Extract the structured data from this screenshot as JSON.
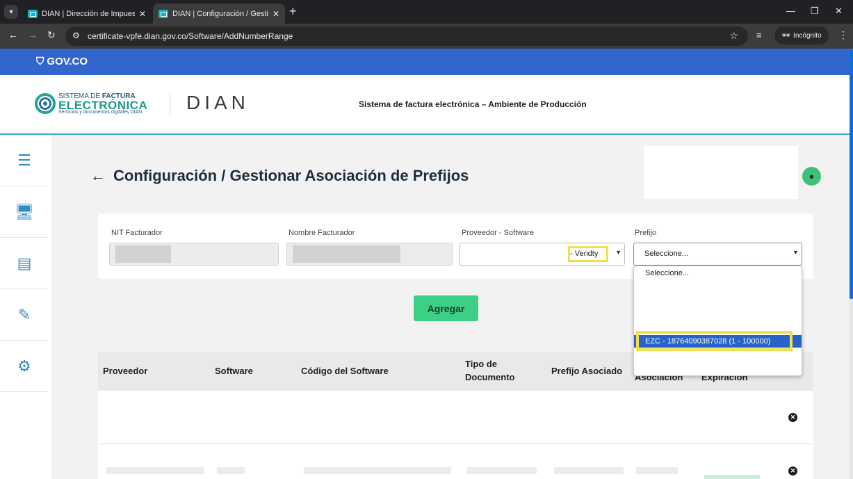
{
  "browser": {
    "tabs": [
      {
        "label": "DIAN | Dirección de Impuestos"
      },
      {
        "label": "DIAN | Configuración / Gestion"
      }
    ],
    "url": "certificate-vpfe.dian.gov.co/Software/AddNumberRange",
    "incognito_label": "Incógnito"
  },
  "gov": {
    "logo": "GOV.CO"
  },
  "header": {
    "sfe_line1_a": "SISTEMA DE ",
    "sfe_line1_b": "FACTURA",
    "sfe_line2": "ELECTRÓNICA",
    "sfe_line3": "Servicios y documentos digitales DIAN",
    "brand": "DIAN",
    "title": "Sistema de factura electrónica – Ambiente de Producción"
  },
  "page": {
    "title": "Configuración / Gestionar Asociación de Prefijos",
    "back_icon": "arrow-left-icon"
  },
  "form": {
    "nit_label": "NIT Facturador",
    "nombre_label": "Nombre Facturador",
    "proveedor_label": "Proveedor - Software",
    "proveedor_value": "- Vendty",
    "prefijo_label": "Prefijo",
    "prefijo_value": "Seleccione...",
    "add_button": "Agregar"
  },
  "dropdown": {
    "options": [
      {
        "label": "Seleccione..."
      },
      {
        "label": "EZC - 18764090387028 (1 - 100000)",
        "selected": true
      }
    ]
  },
  "table": {
    "headers": {
      "proveedor": "Proveedor",
      "software": "Software",
      "codigo": "Código del Software",
      "tipo_1": "Tipo de",
      "tipo_2": "Documento",
      "prefijo": "Prefijo Asociado",
      "asociacion": "Asociación",
      "expiracion": "Expiración"
    }
  },
  "colors": {
    "gov_blue": "#3366cc",
    "accent_green": "#3ccf85",
    "highlight": "#f1e04b",
    "selected_option": "#2864c8"
  }
}
